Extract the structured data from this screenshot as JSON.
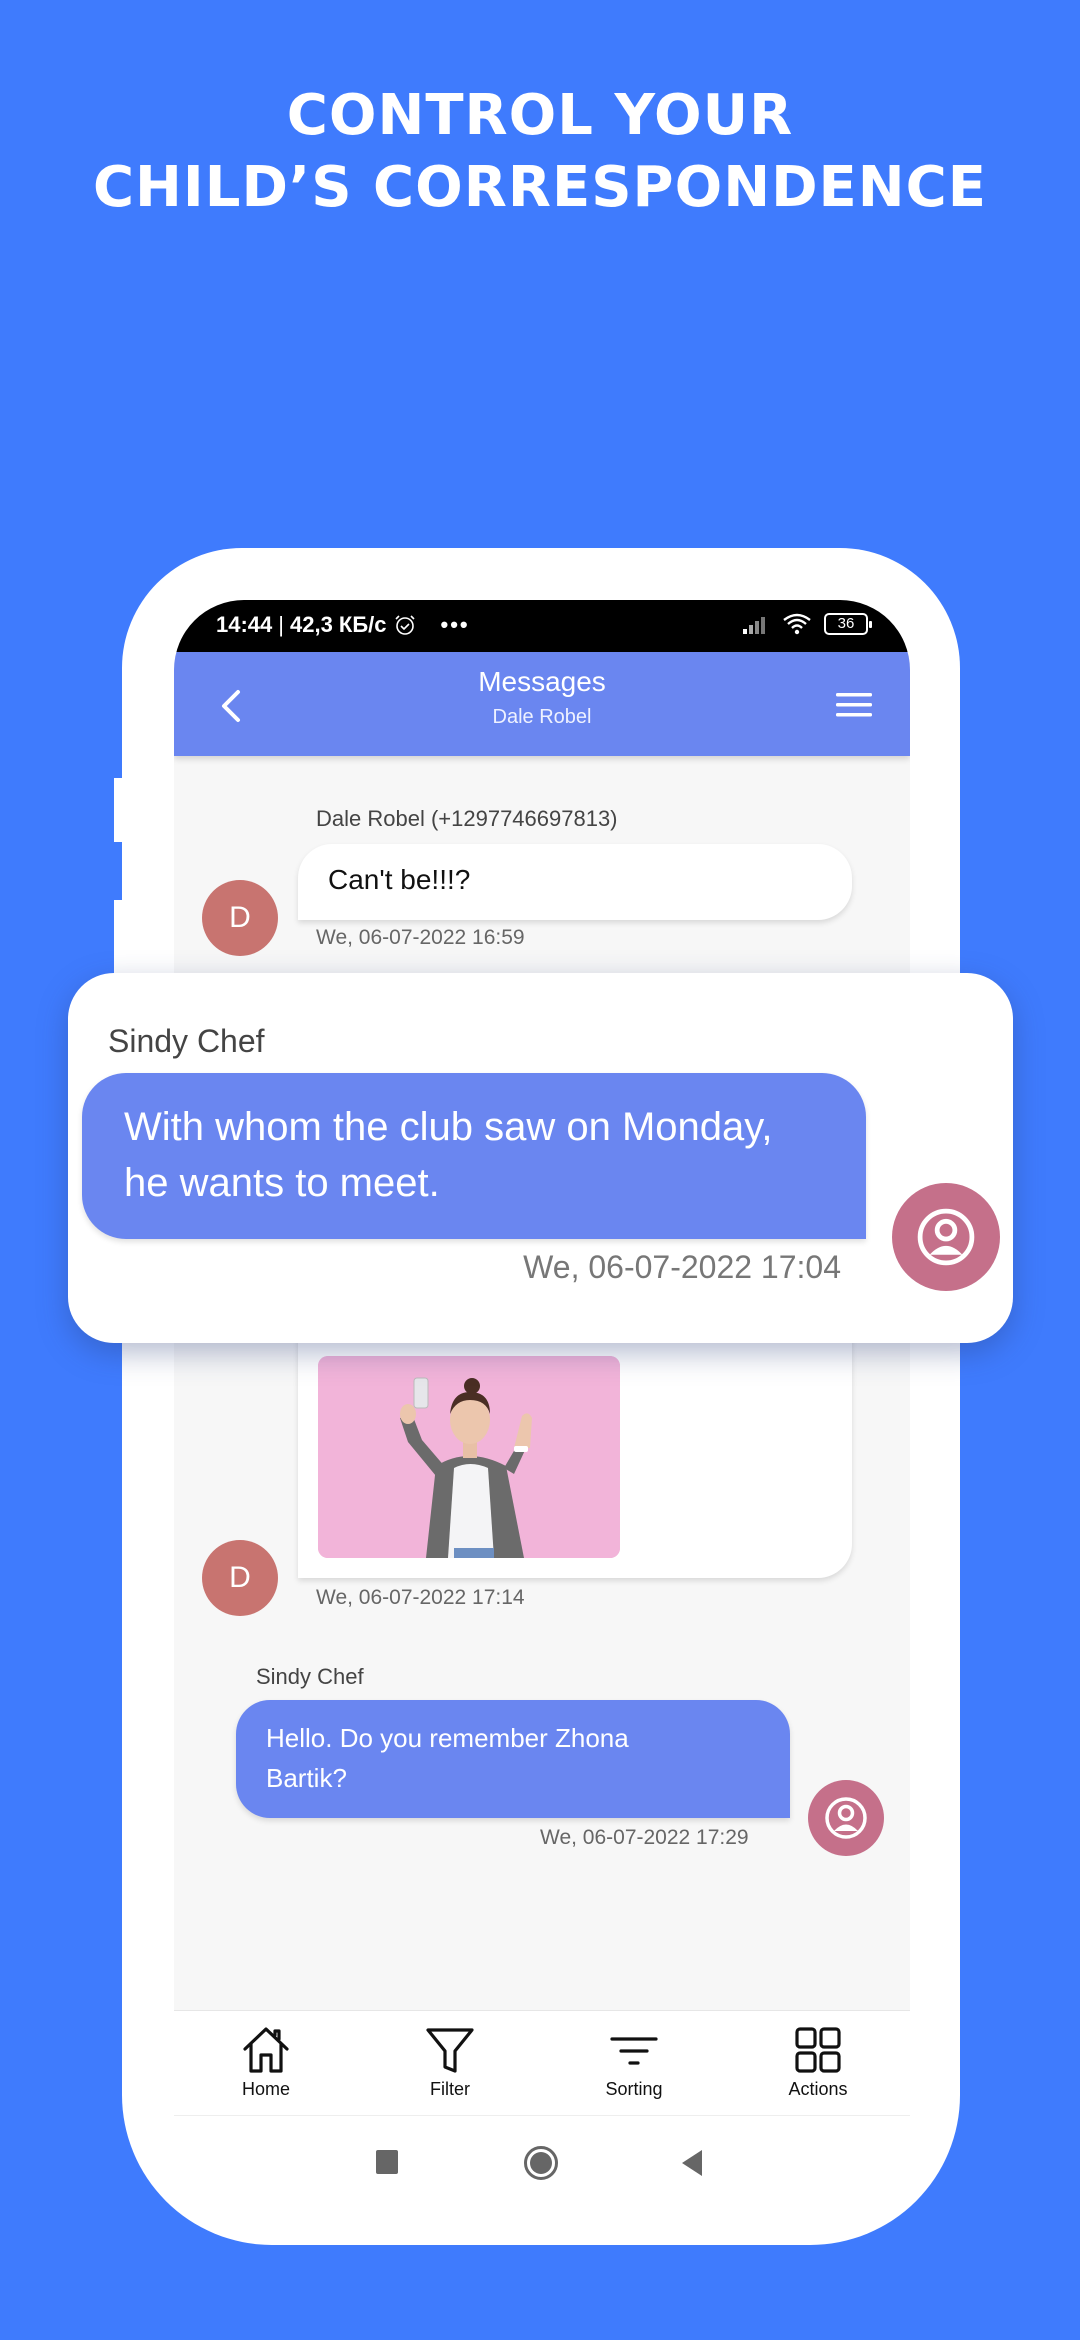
{
  "headline": {
    "line1": "CONTROL YOUR",
    "line2": "CHILD’S CORRESPONDENCE"
  },
  "colors": {
    "background": "#3f7bfd",
    "header": "#6a86f0",
    "outgoing_bubble": "#6a86f0",
    "contact_avatar": "#c87470",
    "user_avatar": "#c5708a"
  },
  "status_bar": {
    "time": "14:44",
    "speed": "42,3 КБ/с",
    "battery": "36",
    "icons": [
      "alarm-icon",
      "more-dots-icon",
      "signal-icon",
      "wifi-icon",
      "battery-icon"
    ]
  },
  "app_header": {
    "title": "Messages",
    "subtitle": "Dale Robel",
    "back_icon": "chevron-left-icon",
    "menu_icon": "hamburger-menu-icon"
  },
  "messages": [
    {
      "direction": "incoming",
      "sender": "Dale Robel (+1297746697813)",
      "text": "Can't be!!!?",
      "timestamp": "We, 06-07-2022 16:59",
      "avatar_initial": "D"
    },
    {
      "direction": "outgoing",
      "sender": "Sindy Chef",
      "text": "With whom the club saw on Monday, he wants to meet.",
      "timestamp": "We, 06-07-2022 17:04",
      "avatar_icon": "user-circle-icon",
      "highlighted": true
    },
    {
      "direction": "incoming",
      "sender": "",
      "attachment": "photo of girl taking selfie on pink background",
      "timestamp": "We, 06-07-2022 17:14",
      "avatar_initial": "D"
    },
    {
      "direction": "outgoing",
      "sender": "Sindy Chef",
      "text": "Hello. Do you remember Zhona Bartik?",
      "timestamp": "We, 06-07-2022 17:29",
      "avatar_icon": "user-circle-icon"
    }
  ],
  "bottom_nav": [
    {
      "label": "Home",
      "icon": "home-icon"
    },
    {
      "label": "Filter",
      "icon": "filter-icon"
    },
    {
      "label": "Sorting",
      "icon": "sort-icon"
    },
    {
      "label": "Actions",
      "icon": "grid-icon"
    }
  ],
  "system_nav": [
    "recents-square-icon",
    "home-circle-icon",
    "back-triangle-icon"
  ]
}
